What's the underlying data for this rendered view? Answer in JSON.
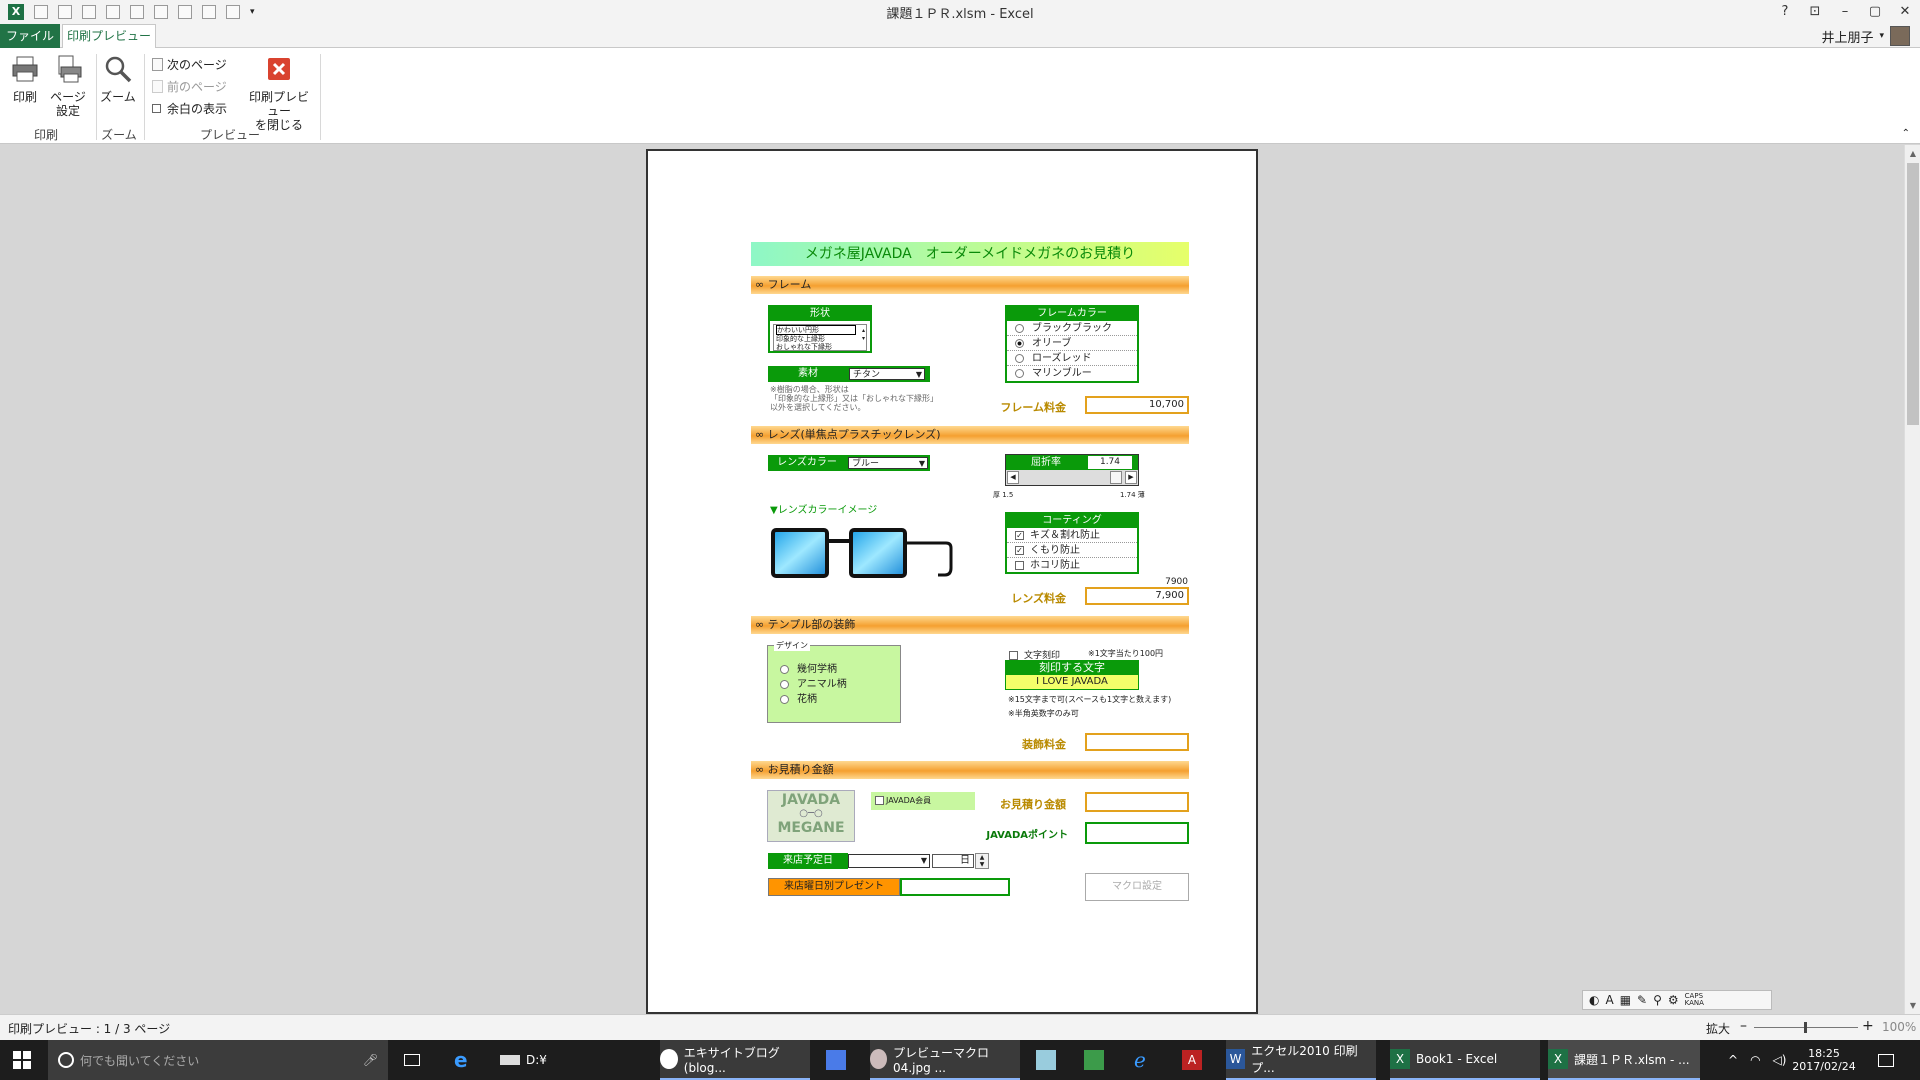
{
  "window": {
    "title": "課題１ＰＲ.xlsm - Excel",
    "help": "?",
    "min": "–",
    "max": "▢",
    "close": "✕"
  },
  "tabs": {
    "file": "ファイル",
    "print_preview": "印刷プレビュー"
  },
  "user": {
    "name": "井上朋子"
  },
  "ribbon": {
    "print": "印刷",
    "page_setup_1": "ページ",
    "page_setup_2": "設定",
    "zoom": "ズーム",
    "next_page": "次のページ",
    "prev_page": "前のページ",
    "show_margins": "余白の表示",
    "close_preview_1": "印刷プレビュー",
    "close_preview_2": "を閉じる",
    "group_print": "印刷",
    "group_zoom": "ズーム",
    "group_preview": "プレビュー"
  },
  "sheet": {
    "title": "メガネ屋JAVADA　オーダーメイドメガネのお見積り",
    "frame_section": "∞ フレーム",
    "shape_header": "形状",
    "shape_items": [
      "かわいい円形",
      "印象的な上縁形",
      "おしゃれな下縁形"
    ],
    "material_label": "素材",
    "material_value": "チタン",
    "material_note_1": "※樹脂の場合、形状は",
    "material_note_2": "「印象的な上縁形」又は「おしゃれな下縁形」",
    "material_note_3": "以外を選択してください。",
    "frame_color_header": "フレームカラー",
    "frame_colors": [
      "ブラックブラック",
      "オリーブ",
      "ローズレッド",
      "マリンブルー"
    ],
    "frame_price_label": "フレーム料金",
    "frame_price": "10,700",
    "lens_section": "∞ レンズ(単焦点プラスチックレンズ)",
    "lens_color_label": "レンズカラー",
    "lens_color_value": "ブルー",
    "lens_image_label": "▼レンズカラーイメージ",
    "refraction_label": "屈折率",
    "refraction_value": "1.74",
    "thick_label": "厚 1.5",
    "thin_label": "1.74 薄",
    "coating_header": "コーティング",
    "coatings": [
      {
        "label": "キズ＆割れ防止",
        "checked": "✓"
      },
      {
        "label": "くもり防止",
        "checked": "✓"
      },
      {
        "label": "ホコリ防止",
        "checked": ""
      }
    ],
    "lens_raw": "7900",
    "lens_price_label": "レンズ料金",
    "lens_price": "7,900",
    "temple_section": "∞ テンプル部の装飾",
    "design_label": "デザイン",
    "designs": [
      "幾何学柄",
      "アニマル柄",
      "花柄"
    ],
    "engrave_label": "文字刻印",
    "engrave_note": "※1文字当たり100円",
    "engrave_header": "刻印する文字",
    "engrave_text": "I LOVE JAVADA",
    "engrave_note_2": "※15文字まで可(スペースも1文字と数えます)",
    "engrave_note_3": "※半角英数字のみ可",
    "deco_price_label": "装飾料金",
    "quote_section": "∞ お見積り金額",
    "logo_1": "JAVADA",
    "logo_2": "MEGANE",
    "member_label": "JAVADA会員",
    "quote_label": "お見積り金額",
    "points_label": "JAVADAポイント",
    "visit_label": "来店予定日",
    "day_label": "日",
    "weekday_label": "来店曜日別プレゼント",
    "macro_button": "マクロ設定"
  },
  "status": {
    "page": "印刷プレビュー : 1 / 3 ページ",
    "zoom_label": "拡大",
    "zoom_percent": "100%"
  },
  "taskbar": {
    "search": "何でも聞いてください",
    "items": [
      "D:¥",
      "エキサイトブログ (blog...",
      "プレビューマクロ04.jpg ...",
      "エクセル2010 印刷プ...",
      "Book1 - Excel",
      "課題１ＰＲ.xlsm - ..."
    ],
    "time": "18:25",
    "date": "2017/02/24"
  },
  "colors": {
    "excel_green": "#217346",
    "sheet_green": "#0a9a0a",
    "orange": "#f5a030"
  }
}
